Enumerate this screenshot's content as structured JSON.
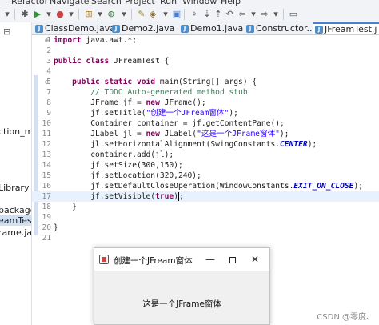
{
  "menu": [
    "Refactor",
    "Navigate",
    "Search",
    "Project",
    "Run",
    "Window",
    "Help"
  ],
  "package_explorer": {
    "items": [
      {
        "text": "ction_map",
        "selected": false
      },
      {
        "text": "Library",
        "selected": false
      },
      {
        "text": "package",
        "selected": false
      },
      {
        "text": "eamTest.ja",
        "selected": true
      },
      {
        "text": "rame.java",
        "selected": false
      }
    ]
  },
  "tabs": [
    {
      "label": "ClassDemo.java",
      "active": false
    },
    {
      "label": "Demo2.java",
      "active": false
    },
    {
      "label": "Demo1.java",
      "active": false
    },
    {
      "label": "Constructor...",
      "active": false
    },
    {
      "label": "JFreamTest.j",
      "active": true
    }
  ],
  "editor": {
    "lines": [
      {
        "n": "1",
        "fold": "⊕",
        "code": "import java.awt.*;"
      },
      {
        "n": "2",
        "fold": "",
        "code": ""
      },
      {
        "n": "3",
        "fold": "",
        "code": "public class JFreamTest {"
      },
      {
        "n": "4",
        "fold": "",
        "code": ""
      },
      {
        "n": "5",
        "fold": "⊝",
        "code": "    public static void main(String[] args) {"
      },
      {
        "n": "7",
        "fold": "",
        "code": "        // TODO Auto-generated method stub"
      },
      {
        "n": "8",
        "fold": "",
        "code": "        JFrame jf = new JFrame();"
      },
      {
        "n": "9",
        "fold": "",
        "code": "        jf.setTitle(\"创建一个JFream窗体\");"
      },
      {
        "n": "10",
        "fold": "",
        "code": "        Container container = jf.getContentPane();"
      },
      {
        "n": "11",
        "fold": "",
        "code": "        JLabel jl = new JLabel(\"这是一个JFrame窗体\");"
      },
      {
        "n": "12",
        "fold": "",
        "code": "        jl.setHorizontalAlignment(SwingConstants.CENTER);"
      },
      {
        "n": "13",
        "fold": "",
        "code": "        container.add(jl);"
      },
      {
        "n": "14",
        "fold": "",
        "code": "        jf.setSize(300,150);"
      },
      {
        "n": "15",
        "fold": "",
        "code": "        jf.setLocation(320,240);"
      },
      {
        "n": "16",
        "fold": "",
        "code": "        jf.setDefaultCloseOperation(WindowConstants.EXIT_ON_CLOSE);"
      },
      {
        "n": "17",
        "fold": "",
        "code": "        jf.setVisible(true);"
      },
      {
        "n": "18",
        "fold": "",
        "code": "    }"
      },
      {
        "n": "19",
        "fold": "",
        "code": ""
      },
      {
        "n": "20",
        "fold": "",
        "code": "}"
      },
      {
        "n": "21",
        "fold": "",
        "code": ""
      }
    ]
  },
  "jframe": {
    "title": "创建一个JFream窗体",
    "minimize": "—",
    "close": "✕",
    "label": "这是一个JFrame窗体"
  },
  "watermark": "CSDN @零度、"
}
